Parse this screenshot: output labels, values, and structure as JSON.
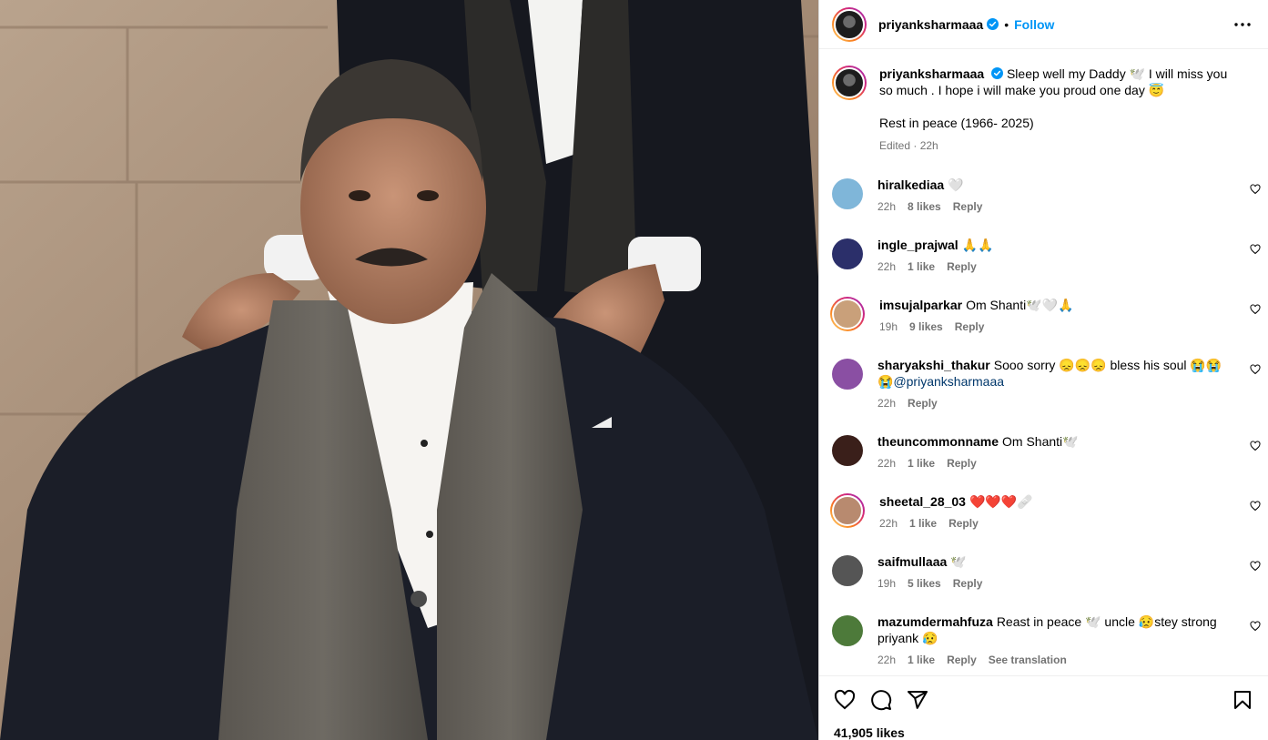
{
  "post": {
    "owner": "priyanksharmaaa",
    "follow_label": "Follow",
    "separator": "•",
    "caption_line1": "Sleep well my Daddy 🕊️ I will miss you so much . I hope i will make you proud one day 😇",
    "caption_line2": "Rest in peace (1966- 2025)",
    "caption_meta": "Edited · 22h",
    "likes": "41,905 likes"
  },
  "comments": [
    {
      "user": "hiralkediaa",
      "text": "🤍",
      "time": "22h",
      "likes": "8 likes",
      "reply": "Reply",
      "avatar_color": "#7fb6d9"
    },
    {
      "user": "ingle_prajwal",
      "text": "🙏🙏",
      "time": "22h",
      "likes": "1 like",
      "reply": "Reply",
      "avatar_color": "#2b2f6a"
    },
    {
      "user": "imsujalparkar",
      "text": "Om Shanti🕊️🤍🙏",
      "time": "19h",
      "likes": "9 likes",
      "reply": "Reply",
      "avatar_color": "#c9a07a"
    },
    {
      "user": "sharyakshi_thakur",
      "text": "Sooo sorry 😞😞😞 bless his soul 😭😭",
      "text2": "😭",
      "mention": "@priyanksharmaaa",
      "time": "22h",
      "likes": "",
      "reply": "Reply",
      "avatar_color": "#8a4fa3"
    },
    {
      "user": "theuncommonname",
      "text": "Om Shanti🕊️",
      "time": "22h",
      "likes": "1 like",
      "reply": "Reply",
      "avatar_color": "#3a1f1a"
    },
    {
      "user": "sheetal_28_03",
      "text": "❤️❤️❤️🩹",
      "time": "22h",
      "likes": "1 like",
      "reply": "Reply",
      "avatar_color": "#b88a6f"
    },
    {
      "user": "saifmullaaa",
      "text": "🕊️",
      "time": "19h",
      "likes": "5 likes",
      "reply": "Reply",
      "avatar_color": "#555555"
    },
    {
      "user": "mazumdermahfuza",
      "text": "Reast in peace 🕊️ uncle 😥stey strong",
      "text2": "priyank 😥",
      "time": "22h",
      "likes": "1 like",
      "reply": "Reply",
      "translate": "See translation",
      "avatar_color": "#4d7a3a"
    }
  ],
  "icons": {
    "more": "more-options-icon",
    "like": "heart-icon",
    "comment": "comment-icon",
    "share": "share-icon",
    "save": "bookmark-icon"
  },
  "colors": {
    "link_blue": "#0095f6",
    "mention_blue": "#00376b",
    "muted": "#737373"
  }
}
